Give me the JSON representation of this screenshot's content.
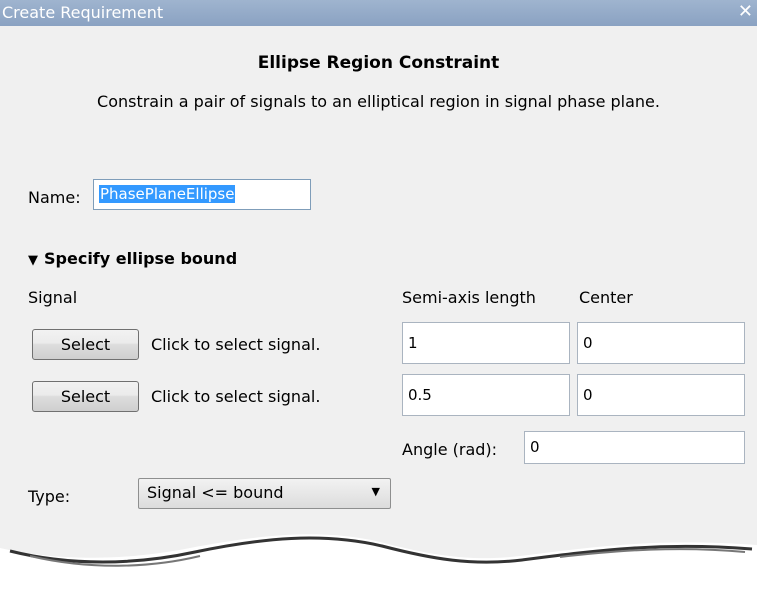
{
  "window": {
    "title": "Create Requirement",
    "close_glyph": "✕"
  },
  "header": {
    "title": "Ellipse Region Constraint",
    "description": "Constrain a pair of signals to an elliptical region in signal phase plane."
  },
  "name_field": {
    "label": "Name:",
    "value": "PhasePlaneEllipse"
  },
  "section": {
    "toggle_glyph": "▼",
    "title": "Specify ellipse bound"
  },
  "columns": {
    "signal": "Signal",
    "semi_axis": "Semi-axis length",
    "center": "Center"
  },
  "signals": [
    {
      "button": "Select",
      "hint": "Click to select signal.",
      "semi_axis": "1",
      "center": "0"
    },
    {
      "button": "Select",
      "hint": "Click to select signal.",
      "semi_axis": "0.5",
      "center": "0"
    }
  ],
  "angle": {
    "label": "Angle (rad):",
    "value": "0"
  },
  "type": {
    "label": "Type:",
    "value": "Signal <= bound",
    "arrow_glyph": "▼"
  },
  "colors": {
    "titlebar": "#8aa2c2",
    "selection": "#3399ff",
    "panel": "#f0f0f0"
  }
}
